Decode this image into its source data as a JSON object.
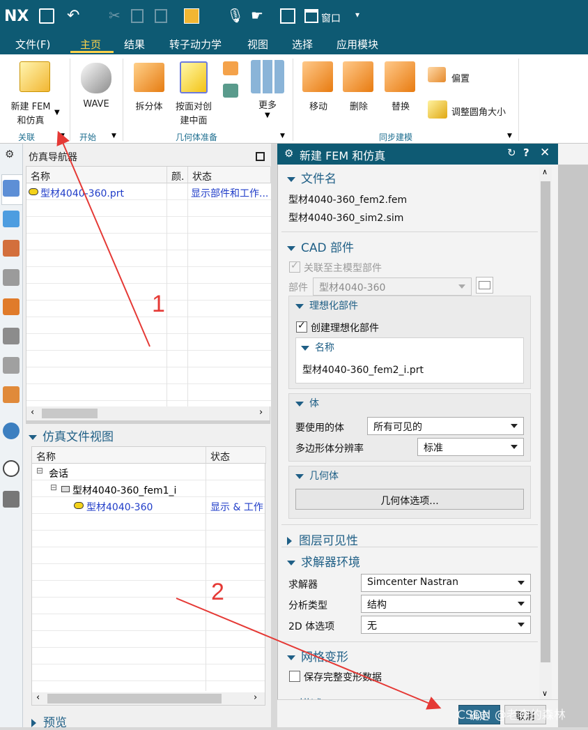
{
  "app": {
    "logo": "NX",
    "window_menu": "窗口"
  },
  "menubar": {
    "items": [
      "文件(F)",
      "主页",
      "结果",
      "转子动力学",
      "视图",
      "选择",
      "应用模块"
    ],
    "active": "主页"
  },
  "ribbon": {
    "new_fem_line1": "新建 FEM",
    "new_fem_line2": "和仿真",
    "wave": "WAVE",
    "split_body": "拆分体",
    "midsurface_line1": "按面对创",
    "midsurface_line2": "建中面",
    "more": "更多",
    "move": "移动",
    "delete": "删除",
    "replace": "替换",
    "offset": "偏置",
    "resize_blend": "调整圆角大小",
    "groups": {
      "associate": "关联",
      "start": "开始",
      "geometry_prep": "几何体准备",
      "sync_modeling": "同步建模"
    }
  },
  "sim_navigator": {
    "title": "仿真导航器",
    "columns": [
      "名称",
      "颜.",
      "状态"
    ],
    "rows": [
      {
        "name": "型材4040-360.prt",
        "status": "显示部件和工作..."
      }
    ]
  },
  "sim_file_view": {
    "title": "仿真文件视图",
    "columns": [
      "名称",
      "状态"
    ],
    "session": "会话",
    "fem": "型材4040-360_fem1_i",
    "part": "型材4040-360",
    "part_status": "显示 & 工作"
  },
  "preview": "预览",
  "dialog": {
    "title": "新建 FEM 和仿真",
    "file_name": {
      "title": "文件名",
      "fem_file": "型材4040-360_fem2.fem",
      "sim_file": "型材4040-360_sim2.sim"
    },
    "cad_part": {
      "title": "CAD 部件",
      "associate_master": "关联至主模型部件",
      "part_label": "部件",
      "part_value": "型材4040-360",
      "idealized": {
        "title": "理想化部件",
        "create_label": "创建理想化部件",
        "name_title": "名称",
        "name_value": "型材4040-360_fem2_i.prt"
      },
      "body": {
        "title": "体",
        "bodies_label": "要使用的体",
        "bodies_value": "所有可见的",
        "resolution_label": "多边形体分辨率",
        "resolution_value": "标准"
      },
      "geometry": {
        "title": "几何体",
        "options_button": "几何体选项..."
      }
    },
    "layer_visibility": {
      "title": "图层可见性"
    },
    "solver_env": {
      "title": "求解器环境",
      "solver_label": "求解器",
      "solver_value": "Simcenter Nastran",
      "analysis_label": "分析类型",
      "analysis_value": "结构",
      "options2d_label": "2D 体选项",
      "options2d_value": "无"
    },
    "mesh_morph": {
      "title": "网格变形",
      "save_label": "保存完整变形数据"
    },
    "description_partial": "描述",
    "ok": "确定",
    "cancel": "取消"
  },
  "annotations": {
    "n1": "1",
    "n2": "2",
    "watermark": "CSDN @老李的森林"
  }
}
